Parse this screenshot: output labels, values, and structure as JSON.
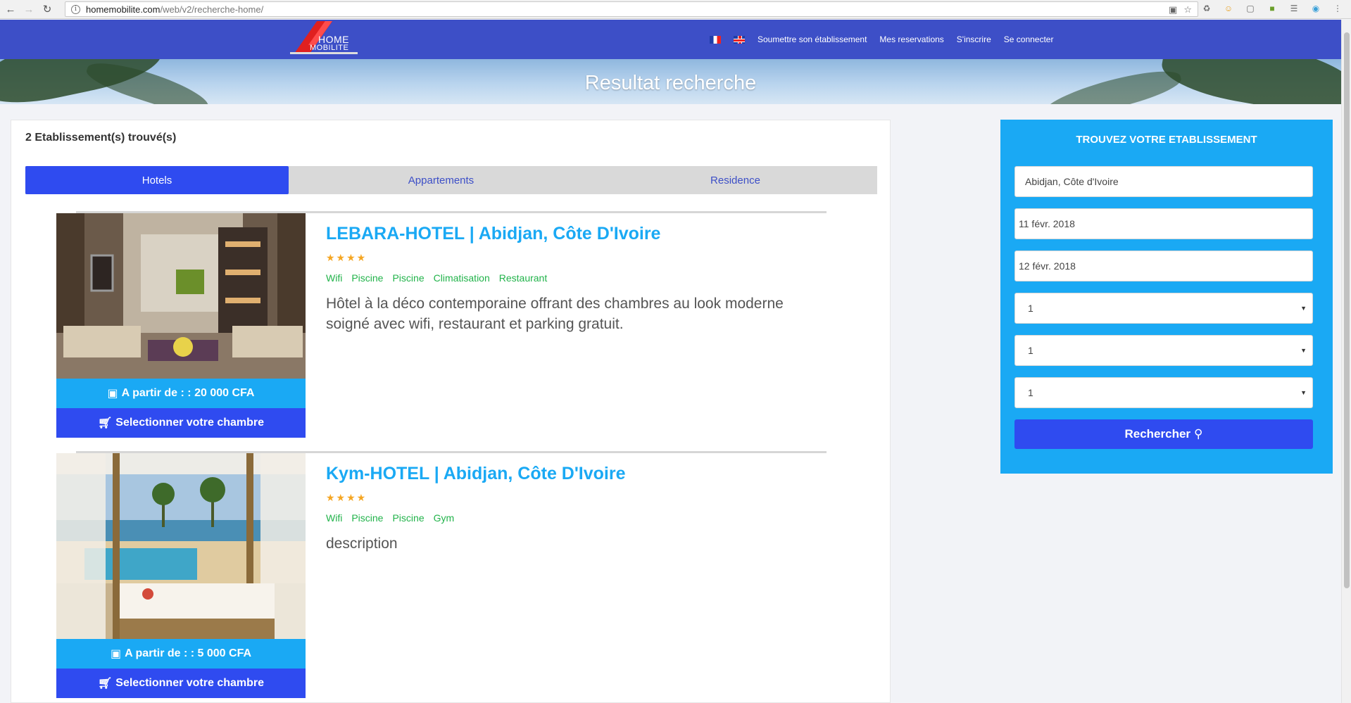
{
  "browser": {
    "url_host": "homemobilite.com",
    "url_path": "/web/v2/recherche-home/"
  },
  "header": {
    "logo_line1": "HOME",
    "logo_line2": "MOBILITE",
    "nav": [
      "Soumettre son établissement",
      "Mes reservations",
      "S'inscrire",
      "Se connecter"
    ]
  },
  "banner": {
    "title": "Resultat recherche"
  },
  "results": {
    "count_label": "2 Etablissement(s) trouvé(s)",
    "tabs": [
      "Hotels",
      "Appartements",
      "Residence"
    ],
    "active_tab": "Hotels",
    "listings": [
      {
        "title": "LEBARA-HOTEL | Abidjan, Côte D'Ivoire",
        "stars": "★★★★",
        "amenities": [
          "Wifi",
          "Piscine",
          "Piscine",
          "Climatisation",
          "Restaurant"
        ],
        "description": "Hôtel à la déco contemporaine offrant des chambres au look moderne soigné avec wifi, restaurant et parking gratuit.",
        "price": "A partir de : : 20 000 CFA",
        "select_label": "Selectionner votre chambre"
      },
      {
        "title": "Kym-HOTEL | Abidjan, Côte D'Ivoire",
        "stars": "★★★★",
        "amenities": [
          "Wifi",
          "Piscine",
          "Piscine",
          "Gym"
        ],
        "description": "description",
        "price": "A partir de : : 5 000 CFA",
        "select_label": "Selectionner votre chambre"
      }
    ]
  },
  "search": {
    "heading": "TROUVEZ VOTRE ETABLISSEMENT",
    "destination": "Abidjan, Côte d'Ivoire",
    "checkin": "11 févr. 2018",
    "checkout": "12 févr. 2018",
    "select1": "1",
    "select2": "1",
    "select3": "1",
    "button": "Rechercher"
  },
  "colors": {
    "header_bg": "#3d4fc7",
    "accent_blue": "#1aa9f4",
    "button_blue": "#2f4bf0",
    "amenity_green": "#21b34a",
    "star_gold": "#f5a623"
  }
}
